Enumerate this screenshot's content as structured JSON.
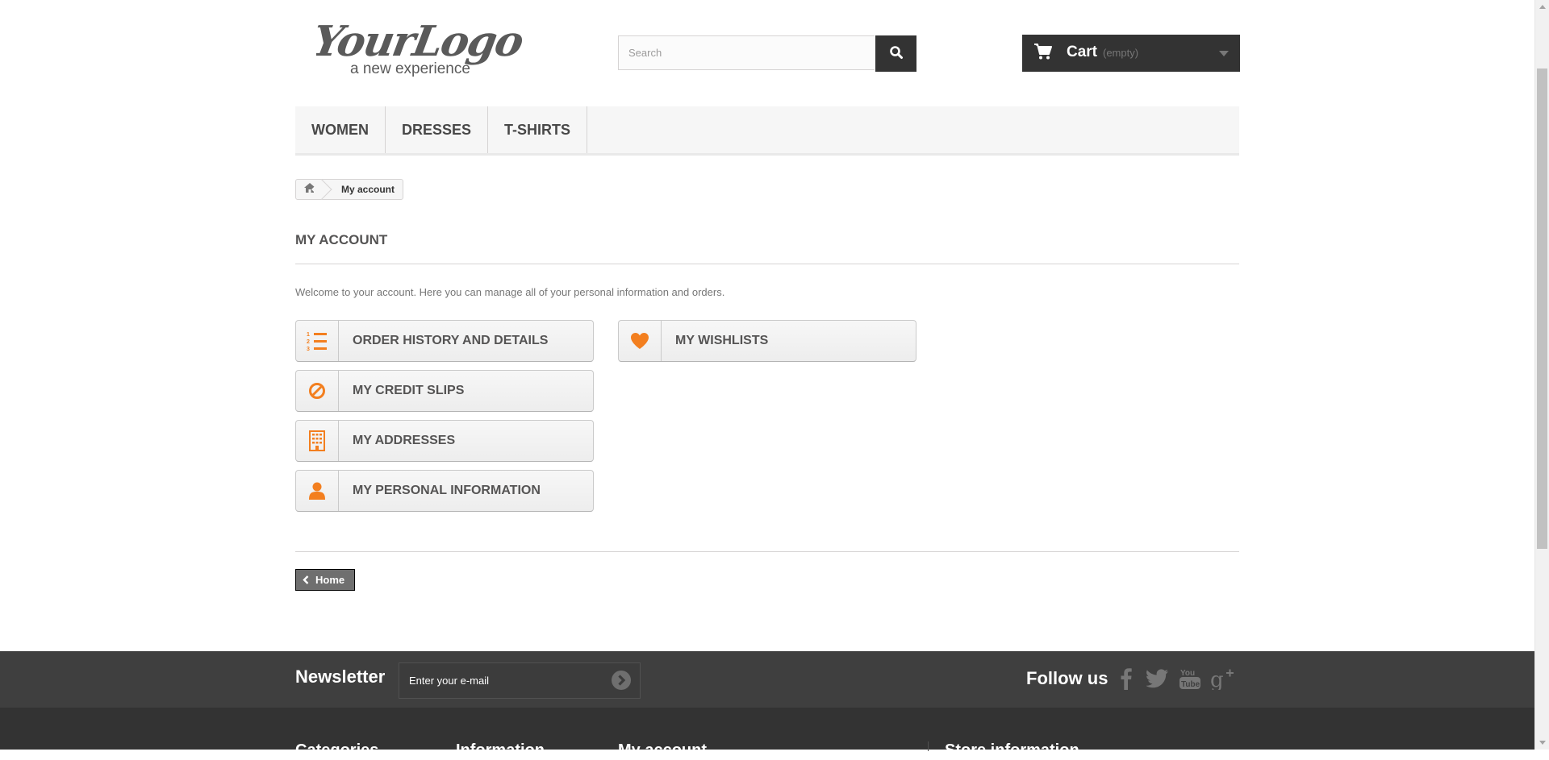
{
  "header": {
    "logo_text": "YourLogo",
    "logo_tagline": "a new experience",
    "search_placeholder": "Search",
    "cart_label": "Cart",
    "cart_status": "(empty)"
  },
  "menu": {
    "items": [
      "Women",
      "Dresses",
      "T-shirts"
    ]
  },
  "breadcrumb": {
    "current": "My account"
  },
  "page": {
    "title": "My account",
    "intro": "Welcome to your account. Here you can manage all of your personal information and orders.",
    "buttons": {
      "order_history": "Order history and details",
      "credit_slips": "My credit slips",
      "addresses": "My addresses",
      "personal_info": "My personal information",
      "wishlists": "My wishlists"
    },
    "home_label": "Home"
  },
  "footer": {
    "newsletter_title": "Newsletter",
    "newsletter_placeholder": "Enter your e-mail",
    "follow_title": "Follow us",
    "columns": [
      "Categories",
      "Information",
      "My account",
      "Store information"
    ]
  },
  "colors": {
    "accent_orange": "#f37f1f",
    "dark": "#333333"
  }
}
